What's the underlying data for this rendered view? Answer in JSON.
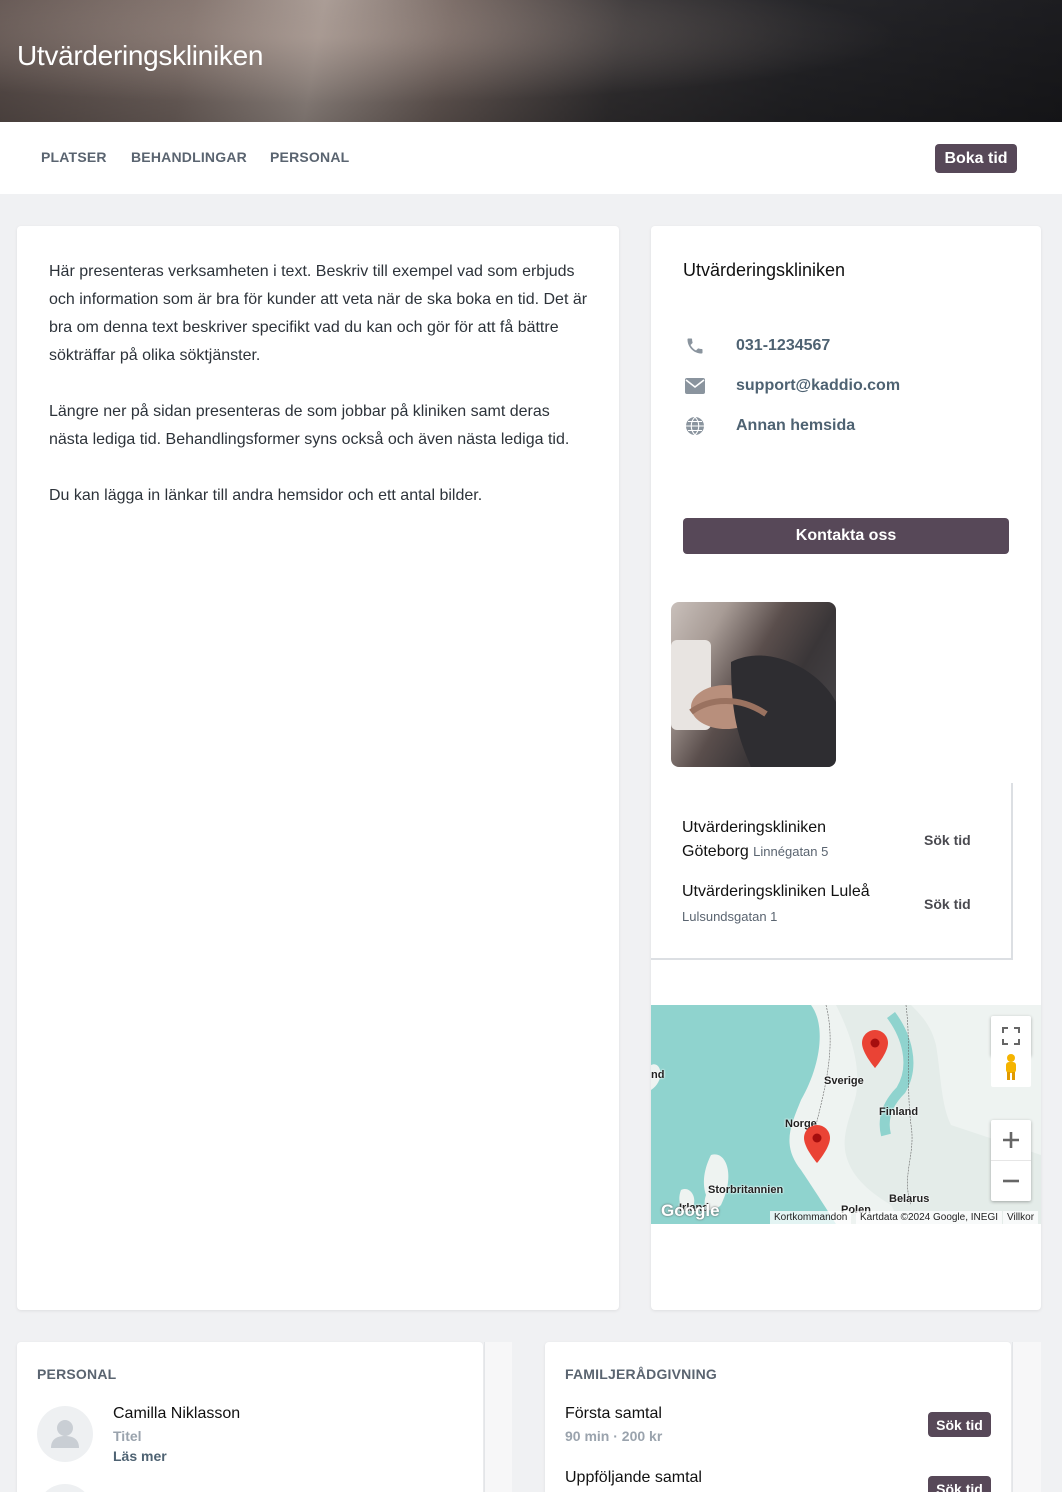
{
  "header": {
    "title": "Utvärderingskliniken"
  },
  "nav": {
    "items": [
      "PLATSER",
      "BEHANDLINGAR",
      "PERSONAL"
    ],
    "book_label": "Boka tid"
  },
  "description": {
    "paragraphs": [
      "Här presenteras verksamheten i text. Beskriv till exempel vad som erbjuds och information som är bra för kunder att veta när de ska boka en tid. Det är bra om denna text beskriver specifikt vad du kan och gör för att få bättre sökträffar på olika söktjänster.",
      "Längre ner på sidan presenteras de som jobbar på kliniken samt deras nästa lediga tid. Behandlingsformer syns också och även nästa lediga tid.",
      "Du kan lägga in länkar till andra hemsidor och ett antal bilder."
    ]
  },
  "sidebar": {
    "title": "Utvärderingskliniken",
    "phone": "031-1234567",
    "email": "support@kaddio.com",
    "website": "Annan hemsida",
    "contact_button": "Kontakta oss",
    "icons": {
      "phone": "phone-icon",
      "email": "envelope-icon",
      "website": "globe-icon"
    }
  },
  "locations": [
    {
      "name_line1": "Utvärderingskliniken",
      "name_line2": "Göteborg",
      "address": "Linnégatan 5",
      "action": "Sök tid"
    },
    {
      "name_line1": "Utvärderingskliniken Luleå",
      "address": "Lulsundsgatan 1",
      "action": "Sök tid"
    }
  ],
  "map": {
    "labels": {
      "sweden": "Sverige",
      "finland": "Finland",
      "norway": "Norge",
      "uk": "Storbritannien",
      "belarus": "Belarus",
      "poland": "Polen",
      "left_cut": "nd",
      "ireland": "Irland"
    },
    "footer": {
      "google": "Google",
      "shortcuts": "Kortkommandon",
      "mapdata": "Kartdata ©2024 Google, INEGI",
      "terms": "Villkor"
    },
    "markers": 2
  },
  "personal": {
    "heading": "PERSONAL",
    "people": [
      {
        "name": "Camilla Niklasson",
        "title": "Titel",
        "more": "Läs mer"
      }
    ]
  },
  "treatments": {
    "heading": "FAMILJERÅDGIVNING",
    "items": [
      {
        "name": "Första samtal",
        "meta": "90 min · 200 kr",
        "action": "Sök tid"
      },
      {
        "name": "Uppföljande samtal",
        "action": "Sök tid"
      }
    ]
  },
  "colors": {
    "accent": "#574858",
    "link": "#4e6272",
    "background": "#f0f1f3"
  }
}
